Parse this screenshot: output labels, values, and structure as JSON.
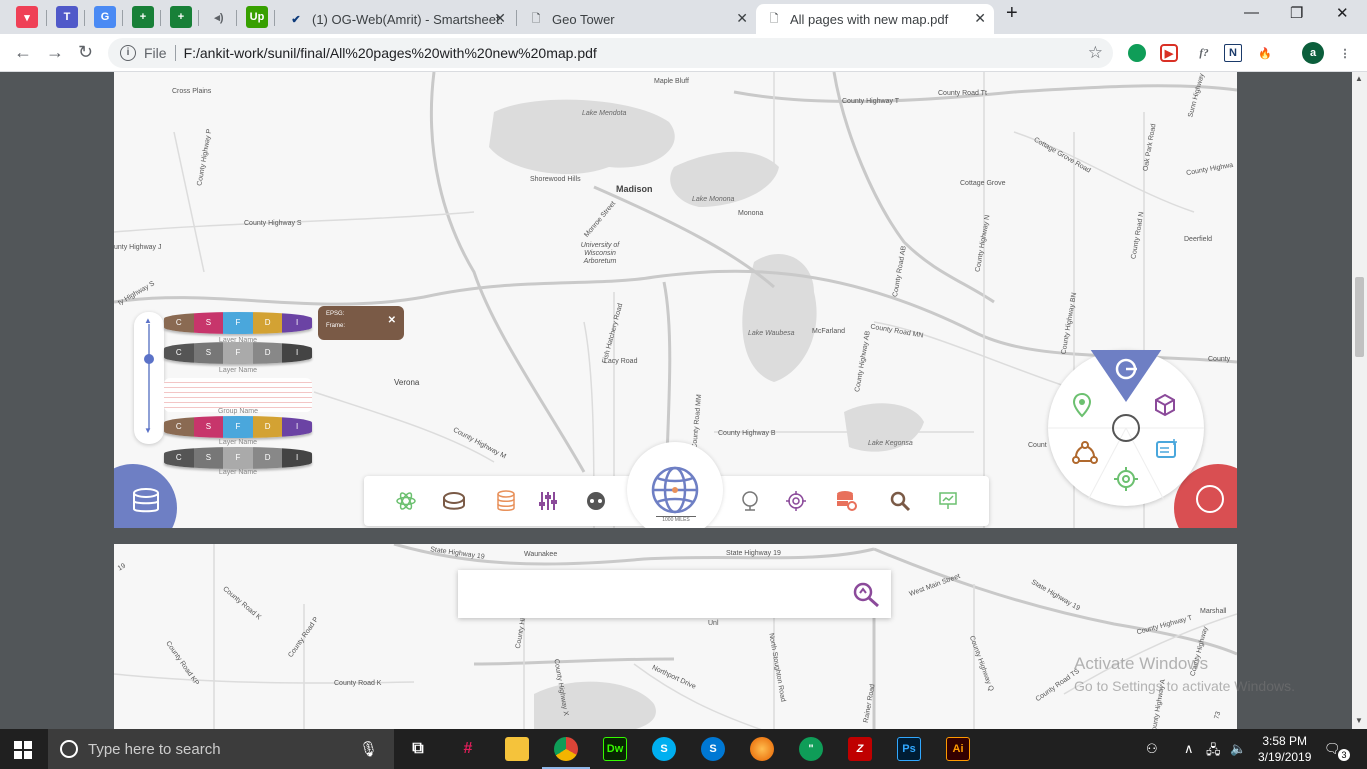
{
  "browser": {
    "tabs": [
      {
        "label": "(1) OG-Web(Amrit) - Smartsheet.",
        "active": false
      },
      {
        "label": "Geo Tower",
        "active": false
      },
      {
        "label": "All pages with new map.pdf",
        "active": true
      }
    ],
    "new_tab": "+",
    "window_controls": {
      "minimize": "—",
      "maximize": "❐",
      "close": "✕"
    },
    "address": {
      "scheme": "File",
      "url": "F:/ankit-work/sunil/final/All%20pages%20with%20new%20map.pdf"
    },
    "profile_letter": "a"
  },
  "map_page1": {
    "labels": {
      "cross_plains": "Cross Plains",
      "maple_bluff": "Maple Bluff",
      "county_hwy_t": "County Highway T",
      "county_road_tt": "County Road Tt",
      "lake_mendota": "Lake Mendota",
      "shorewood_hills": "Shorewood Hills",
      "madison": "Madison",
      "lake_monona": "Lake Monona",
      "monona": "Monona",
      "cottage_grove": "Cottage Grove",
      "cottage_grove_road": "Cottage Grove Road",
      "county_hwy_s": "County Highway S",
      "county_hwy_j": "unty Highway J",
      "univ": "University of Wisconsin Arboretum",
      "monroe_street": "Monroe Street",
      "deerfield": "Deerfield",
      "verona": "Verona",
      "lacy_road": "Lacy Road",
      "mcfarland": "McFarland",
      "county_road_mn": "County Road MN",
      "lake_waubesa": "Lake Waubesa",
      "county_hwy_b": "County Highway B",
      "lake_kegonsa": "Lake Kegonsa",
      "county_hwy_m": "County Highway M",
      "oak_park_road": "Oak Park Road",
      "fish_hatchery": "Fish Hatchery Road",
      "county_hwy_n": "County Highway N",
      "county_road_ab": "County Road AB",
      "county_hwy_bn": "County Highway BN",
      "county_road_mm": "County Road MM",
      "county_hwy_p": "County Highway P",
      "county_hwy_s2": "ty Highway S",
      "county_hwy_short": "County Highwa",
      "county_short": "Count",
      "county_right": "County",
      "county_road_n": "County Road N",
      "sunn_hwy": "Sunn Highway",
      "county_hwy_ab": "County Highway AB"
    },
    "epsg_popup": {
      "line1": "EPSG:",
      "line2": "Frame:",
      "close": "✕"
    },
    "layer_rows": [
      {
        "letters": [
          "C",
          "S",
          "F",
          "D",
          "I"
        ],
        "colors": [
          "#8a6a52",
          "#c7356b",
          "#4aa7dc",
          "#d3a233",
          "#6b43a4"
        ],
        "caption": "Layer Name"
      },
      {
        "letters": [
          "C",
          "S",
          "F",
          "D",
          "I"
        ],
        "colors": [
          "#555555",
          "#777777",
          "#aaaaaa",
          "#888888",
          "#444444"
        ],
        "caption": "Layer Name"
      },
      {
        "letters": [
          "C",
          "S",
          "F",
          "D",
          "I"
        ],
        "colors": [
          "#8a6a52",
          "#c7356b",
          "#4aa7dc",
          "#d3a233",
          "#6b43a4"
        ],
        "caption": "Layer Name"
      },
      {
        "letters": [
          "C",
          "S",
          "F",
          "D",
          "I"
        ],
        "colors": [
          "#555555",
          "#777777",
          "#aaaaaa",
          "#888888",
          "#444444"
        ],
        "caption": "Layer Name"
      }
    ],
    "group_name": "Group Name",
    "scale_text": "1000 MILES"
  },
  "map_page2": {
    "labels": {
      "sh19_left": "State Highway 19",
      "waunakee": "Waunakee",
      "sh19_right": "State Highway 19",
      "sh19_edge": "19",
      "county_road_k": "County Road K",
      "county_road_p": "County Road P",
      "county_road_kp": "County Road KP",
      "county_road_k2": "County Road K",
      "west_main": "West Main Street",
      "sh19_far": "State Highway 19",
      "marshall": "Marshall",
      "county_hwy_t": "County Highway T",
      "northport": "Northport Drive",
      "north_sherman": "North Stoughton Road",
      "rainer": "Rainer Road",
      "county_hwy_x": "County Highway X",
      "county_hwy_a": "County Highway A",
      "county_road_ts": "County Road TS",
      "county_hwy_sp": "County Hig",
      "county_hwy_q": "County Highway Q",
      "county_hwy_st": "County Highway",
      "unl": "Unl",
      "county_road_73": "73"
    },
    "watermark": {
      "line1": "Activate Windows",
      "line2": "Go to Settings to activate Windows."
    }
  },
  "taskbar": {
    "search_placeholder": "Type here to search",
    "time": "3:58 PM",
    "date": "3/19/2019",
    "notification_count": "3"
  },
  "colors": {
    "accent_blue": "#6e7fc4",
    "accent_red": "#d94f52",
    "popup_brown": "#7a5a46"
  }
}
